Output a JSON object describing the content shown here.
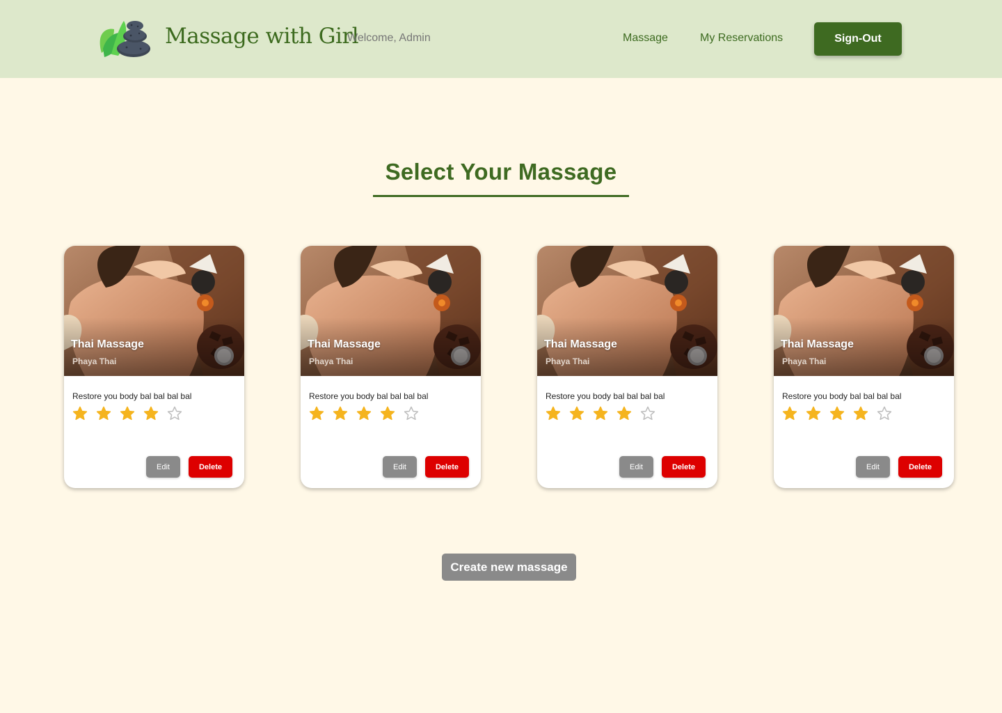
{
  "header": {
    "brand": "Massage with Girl",
    "welcome": "Welcome, Admin",
    "nav": {
      "massage": "Massage",
      "reservations": "My Reservations"
    },
    "signout_label": "Sign-Out"
  },
  "main": {
    "title": "Select Your Massage",
    "create_label": "Create new massage"
  },
  "cards": [
    {
      "title": "Thai Massage",
      "location": "Phaya Thai",
      "description": "Restore you body bal bal bal bal",
      "rating": 4,
      "max_rating": 5,
      "edit_label": "Edit",
      "delete_label": "Delete"
    },
    {
      "title": "Thai Massage",
      "location": "Phaya Thai",
      "description": "Restore you body bal bal bal bal",
      "rating": 4,
      "max_rating": 5,
      "edit_label": "Edit",
      "delete_label": "Delete"
    },
    {
      "title": "Thai Massage",
      "location": "Phaya Thai",
      "description": "Restore you body bal bal bal bal",
      "rating": 4,
      "max_rating": 5,
      "edit_label": "Edit",
      "delete_label": "Delete"
    },
    {
      "title": "Thai Massage",
      "location": "Phaya Thai",
      "description": "Restore you body bal bal bal bal",
      "rating": 4,
      "max_rating": 5,
      "edit_label": "Edit",
      "delete_label": "Delete"
    }
  ],
  "colors": {
    "page_bg": "#fff8e7",
    "header_bg": "#dde8cb",
    "brand_green": "#3e6a21",
    "star_filled": "#f5b41e",
    "star_empty": "#bdbdbd",
    "delete_red": "#dd0000",
    "neutral_gray": "#8a8a8a"
  },
  "icons": {
    "logo": "spa-stones-leaf-icon",
    "rating": "star-icon"
  }
}
